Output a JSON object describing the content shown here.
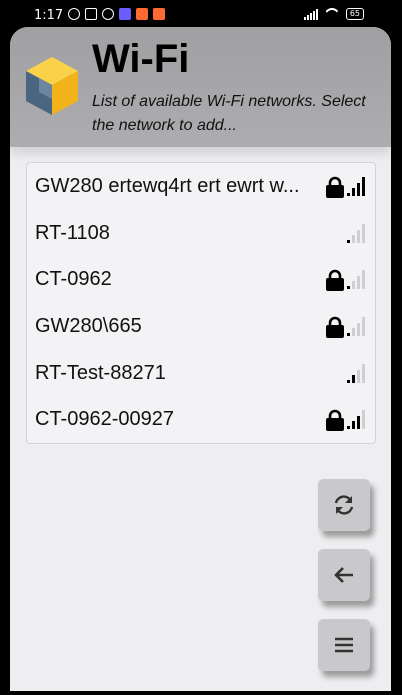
{
  "status_bar": {
    "time": "1:17",
    "battery": "65",
    "icons": [
      "alarm-off-icon",
      "nfc-icon",
      "headphones-icon",
      "app-notification-icon",
      "app-notification-icon",
      "app-notification-icon"
    ]
  },
  "header": {
    "title": "Wi-Fi",
    "subtitle": "List of available Wi-Fi networks. Select the network to add..."
  },
  "networks": [
    {
      "name": "GW280 ertewq4rt ert ewrt w...",
      "secured": true,
      "signal": 4
    },
    {
      "name": "RT-1108",
      "secured": false,
      "signal": 1
    },
    {
      "name": "CT-0962",
      "secured": true,
      "signal": 1
    },
    {
      "name": "GW280\\665",
      "secured": true,
      "signal": 1
    },
    {
      "name": "RT-Test-88271",
      "secured": false,
      "signal": 2
    },
    {
      "name": "CT-0962-00927",
      "secured": true,
      "signal": 3
    }
  ],
  "actions": [
    {
      "name": "refresh-button",
      "icon": "refresh-icon"
    },
    {
      "name": "back-button",
      "icon": "arrow-left-icon"
    },
    {
      "name": "menu-button",
      "icon": "hamburger-menu-icon"
    }
  ],
  "colors": {
    "header_bg": "#a09fa2",
    "screen_bg": "#eeeef0",
    "logo_yellow": "#f7c21c",
    "logo_blue": "#4a6580",
    "fab_bg": "#c9c9cc"
  }
}
